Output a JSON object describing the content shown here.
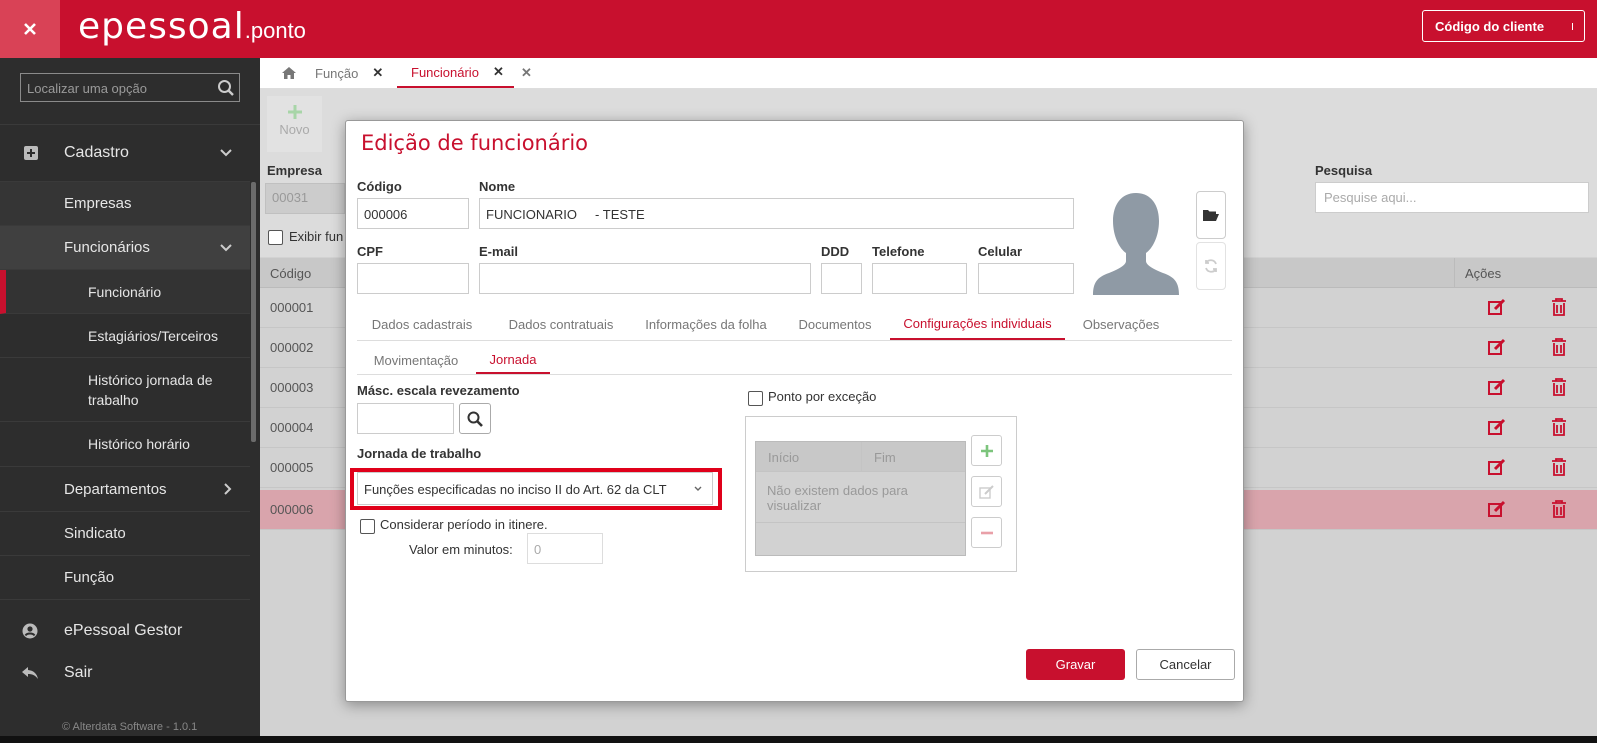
{
  "app": {
    "logo_main": "epessoal",
    "logo_suffix": ".ponto",
    "client_code_label": "Código do cliente"
  },
  "sidebar": {
    "search_placeholder": "Localizar uma opção",
    "items": [
      {
        "label": "Cadastro"
      },
      {
        "label": "Empresas"
      },
      {
        "label": "Funcionários"
      },
      {
        "label": "Funcionário"
      },
      {
        "label": "Estagiários/Terceiros"
      },
      {
        "label": "Histórico jornada de trabalho"
      },
      {
        "label": "Histórico horário"
      },
      {
        "label": "Departamentos"
      },
      {
        "label": "Sindicato"
      },
      {
        "label": "Função"
      }
    ],
    "gestor_label": "ePessoal Gestor",
    "sair_label": "Sair",
    "footer": "© Alterdata Software - 1.0.1"
  },
  "tabs": [
    {
      "label": "Função"
    },
    {
      "label": "Funcionário"
    }
  ],
  "page": {
    "new_label": "Novo",
    "empresa_label": "Empresa",
    "empresa_value": "00031",
    "exibir_label": "Exibir fun",
    "pesquisa_label": "Pesquisa",
    "pesquisa_placeholder": "Pesquise aqui...",
    "col_codigo": "Código",
    "col_acoes": "Ações",
    "rows": [
      "000001",
      "000002",
      "000003",
      "000004",
      "000005",
      "000006"
    ]
  },
  "modal": {
    "title": "Edição de funcionário",
    "codigo_label": "Código",
    "codigo_value": "000006",
    "nome_label": "Nome",
    "nome_value": "FUNCIONARIO     - TESTE",
    "cpf_label": "CPF",
    "email_label": "E-mail",
    "ddd_label": "DDD",
    "telefone_label": "Telefone",
    "celular_label": "Celular",
    "tabs": [
      "Dados cadastrais",
      "Dados contratuais",
      "Informações da folha",
      "Documentos",
      "Configurações individuais",
      "Observações"
    ],
    "subtabs": [
      "Movimentação",
      "Jornada"
    ],
    "masc_label": "Másc. escala revezamento",
    "jornada_label": "Jornada de trabalho",
    "jornada_value": "Funções especificadas no inciso II do Art. 62 da CLT",
    "itinere_label": "Considerar período in itinere.",
    "valor_label": "Valor em minutos:",
    "valor_value": "0",
    "ponto_label": "Ponto por exceção",
    "inicio_label": "Início",
    "fim_label": "Fim",
    "empty_msg": "Não existem dados para visualizar",
    "gravar": "Gravar",
    "cancelar": "Cancelar"
  },
  "colors": {
    "brand": "#c8102e",
    "selected_row": "#d9a4ac",
    "highlight": "#e0001a"
  }
}
